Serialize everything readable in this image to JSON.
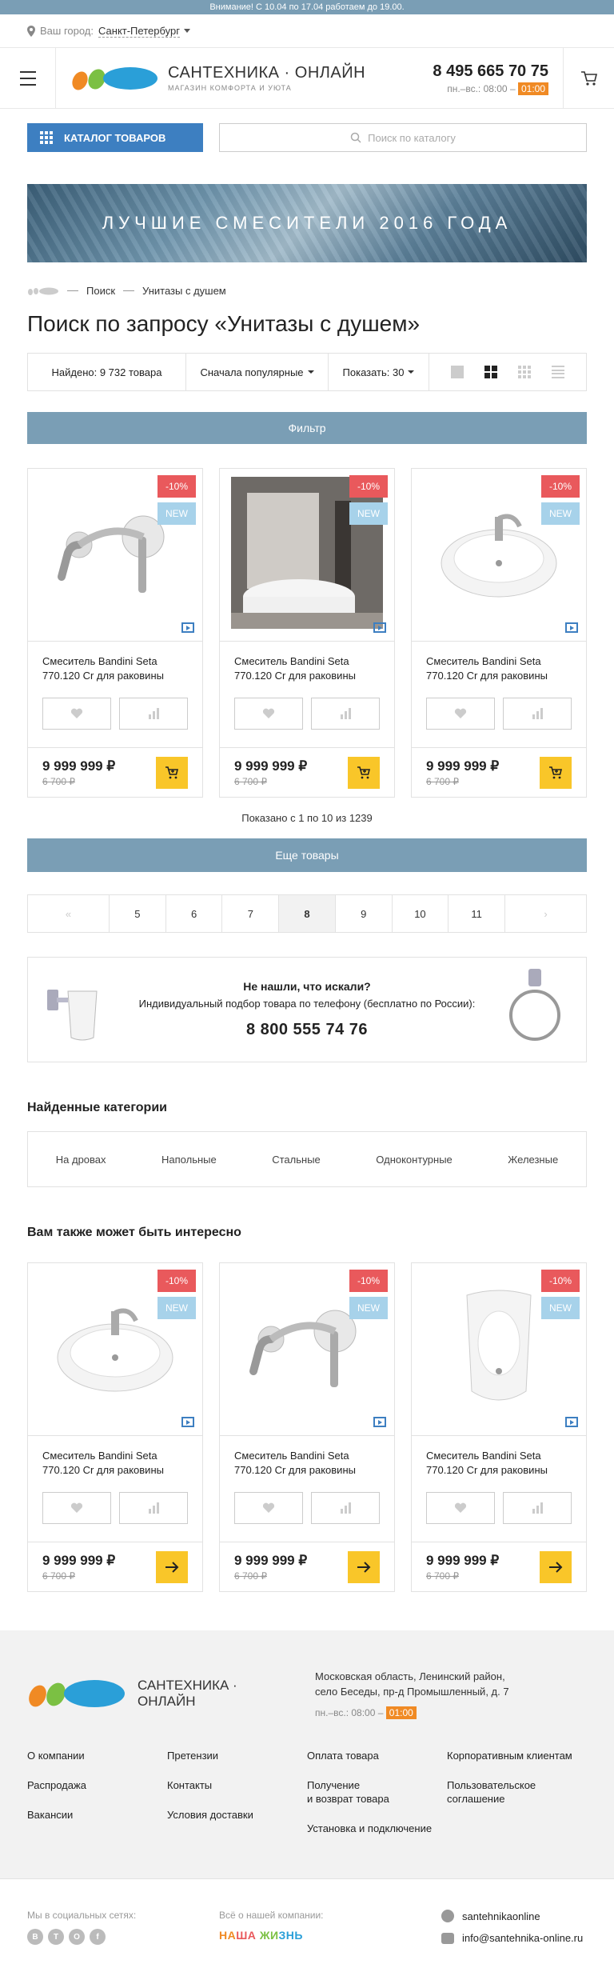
{
  "notice": "Внимание! С 10.04 по 17.04 работаем до 19.00.",
  "city": {
    "label": "Ваш город:",
    "value": "Санкт-Петербург"
  },
  "header": {
    "logo_title": "САНТЕХНИКА · ОНЛАЙН",
    "logo_sub": "МАГАЗИН КОМФОРТА И УЮТА",
    "phone": "8 495 665 70 75",
    "hours_label": "пн.–вс.: 08:00 –",
    "hours_tag": "01:00"
  },
  "catalog_button": "КАТАЛОГ ТОВАРОВ",
  "search": {
    "placeholder": "Поиск по каталогу"
  },
  "banner": "ЛУЧШИЕ СМЕСИТЕЛИ 2016 ГОДА",
  "breadcrumb": {
    "items": [
      "Поиск",
      "Унитазы с душем"
    ]
  },
  "page_title": "Поиск по запросу «Унитазы с душем»",
  "sort_bar": {
    "found": "Найдено: 9 732 товара",
    "sort": "Сначала популярные",
    "show": "Показать: 30"
  },
  "filter_button": "Фильтр",
  "products": [
    {
      "badge_sale": "-10%",
      "badge_new": "NEW",
      "name": "Смеситель Bandini Seta 770.120 Cr для раковины",
      "price": "9 999 999 ₽",
      "old_price": "6 700 ₽",
      "image": "faucet"
    },
    {
      "badge_sale": "-10%",
      "badge_new": "NEW",
      "name": "Смеситель Bandini Seta 770.120 Cr для раковины",
      "price": "9 999 999 ₽",
      "old_price": "6 700 ₽",
      "image": "bathroom"
    },
    {
      "badge_sale": "-10%",
      "badge_new": "NEW",
      "name": "Смеситель Bandini Seta 770.120 Cr для раковины",
      "price": "9 999 999 ₽",
      "old_price": "6 700 ₽",
      "image": "sink"
    }
  ],
  "shown_text": "Показано с 1 по 10 из 1239",
  "more_button": "Еще товары",
  "pagination": {
    "pages": [
      "5",
      "6",
      "7",
      "8",
      "9",
      "10",
      "11"
    ],
    "current": "8"
  },
  "help": {
    "title": "Не нашли, что искали?",
    "text": "Индивидуальный подбор товара по телефону (бесплатно по России):",
    "phone": "8 800 555 74 76"
  },
  "categories_title": "Найденные категории",
  "categories": [
    "На дровах",
    "Напольные",
    "Стальные",
    "Одноконтурные",
    "Железные"
  ],
  "related_title": "Вам также может быть интересно",
  "related": [
    {
      "badge_sale": "-10%",
      "badge_new": "NEW",
      "name": "Смеситель Bandini Seta 770.120 Cr для раковины",
      "price": "9 999 999 ₽",
      "old_price": "6 700 ₽",
      "image": "sink"
    },
    {
      "badge_sale": "-10%",
      "badge_new": "NEW",
      "name": "Смеситель Bandini Seta 770.120 Cr для раковины",
      "price": "9 999 999 ₽",
      "old_price": "6 700 ₽",
      "image": "faucet"
    },
    {
      "badge_sale": "-10%",
      "badge_new": "NEW",
      "name": "Смеситель Bandini Seta 770.120 Cr для раковины",
      "price": "9 999 999 ₽",
      "old_price": "6 700 ₽",
      "image": "urinal"
    }
  ],
  "footer": {
    "logo_line1": "САНТЕХНИКА ·",
    "logo_line2": "ОНЛАЙН",
    "address_line1": "Московская область, Ленинский район,",
    "address_line2": "село Беседы, пр-д Промышленный, д. 7",
    "hours_label": "пн.–вс.: 08:00 –",
    "hours_tag": "01:00",
    "col1": [
      "О компании",
      "Распродажа",
      "Вакансии"
    ],
    "col2": [
      "Претензии",
      "Контакты",
      "Условия доставки"
    ],
    "col3": [
      "Оплата товара",
      "Получение\nи возврат товара",
      "Установка и подключение"
    ],
    "col4": [
      "Корпоративным клиентам",
      "Пользовательское\nсоглашение"
    ],
    "social_label": "Мы в социальных сетях:",
    "social_icons": [
      "В",
      "Т",
      "О",
      "f"
    ],
    "company_label": "Всё о нашей компании:",
    "brand": "НАША ЖИЗНЬ",
    "skype": "santehnikaonline",
    "email": "info@santehnika-online.ru"
  },
  "colors": {
    "accent": "#3d7fc1",
    "steel": "#7a9eb5",
    "sale": "#e9595c",
    "new": "#a7d2ea",
    "buy": "#f9c629",
    "orange": "#f08a24"
  }
}
